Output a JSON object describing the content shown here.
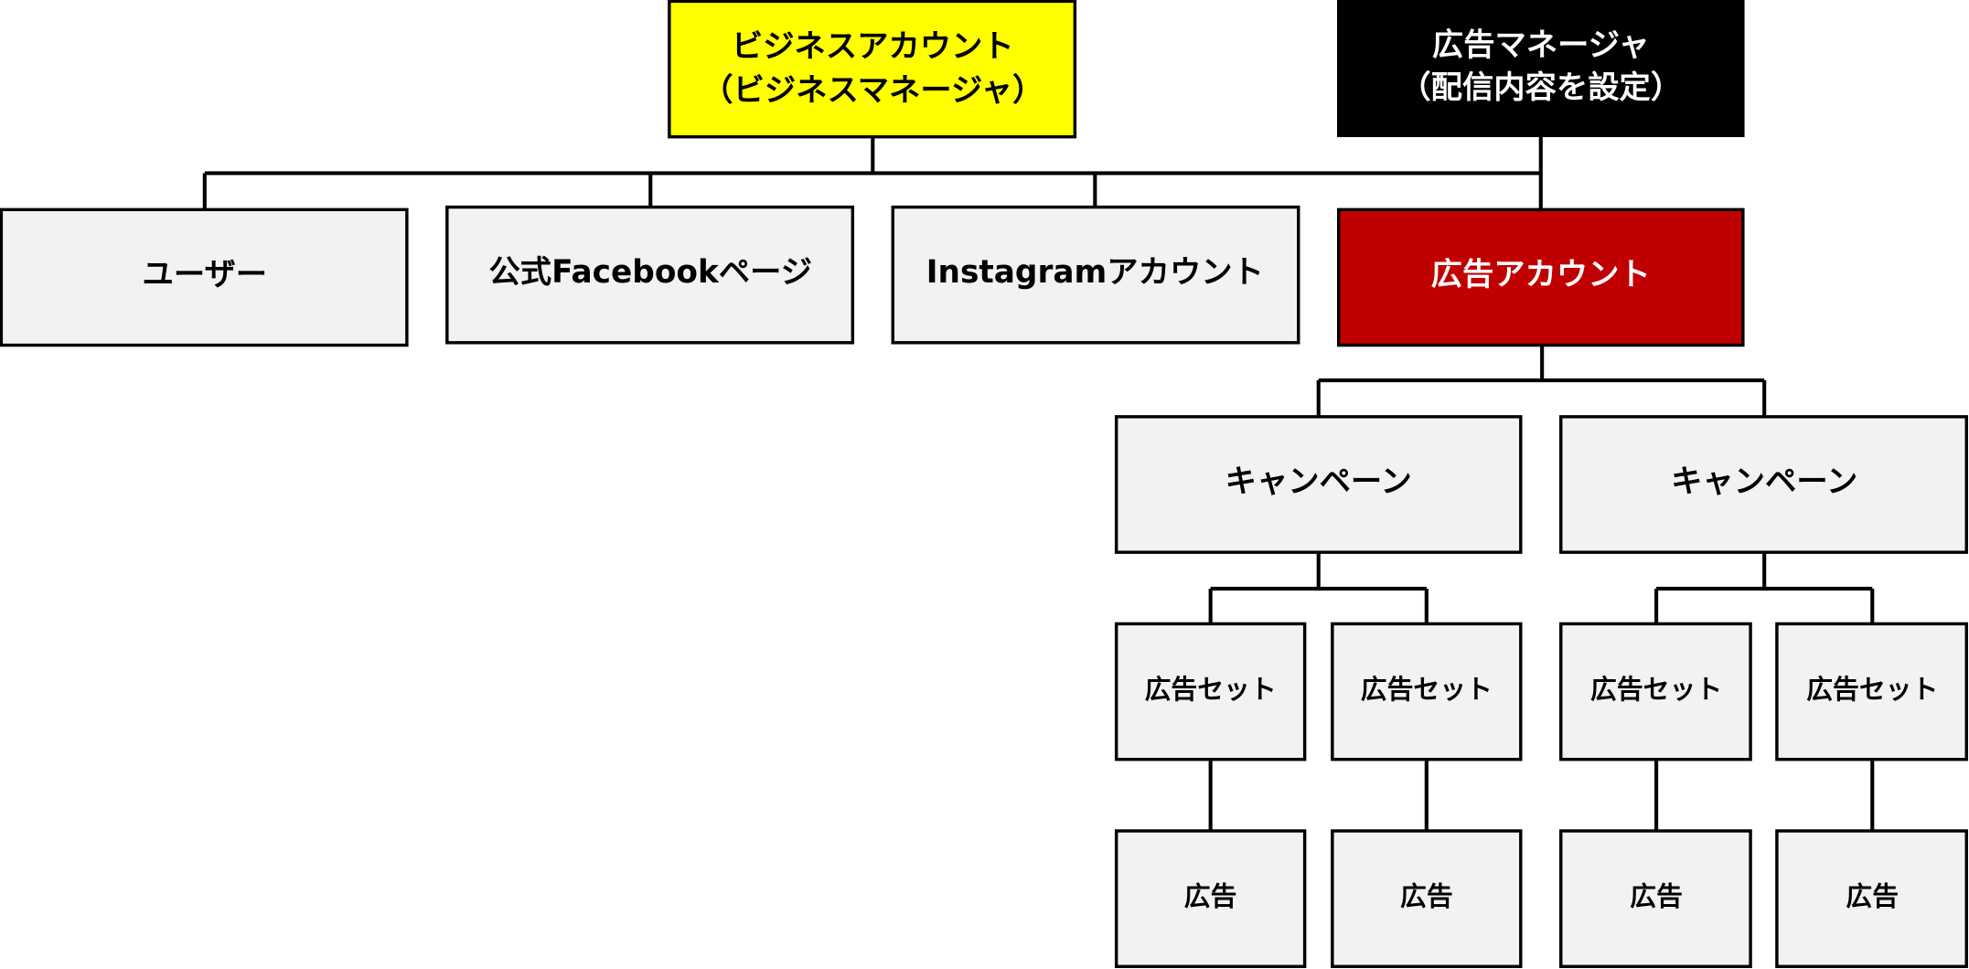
{
  "colors": {
    "business": "#FFFF00",
    "manager": "#000000",
    "ad_account": "#C00000",
    "node": "#F2F2F2"
  },
  "business_account": {
    "line1": "ビジネスアカウント",
    "line2": "（ビジネスマネージャ）"
  },
  "ads_manager": {
    "line1": "広告マネージャ",
    "line2": "（配信内容を設定）"
  },
  "level2": [
    "ユーザー",
    "公式Facebookページ",
    "Instagramアカウント",
    "広告アカウント"
  ],
  "campaigns": [
    "キャンペーン",
    "キャンペーン"
  ],
  "ad_sets": [
    "広告セット",
    "広告セット",
    "広告セット",
    "広告セット"
  ],
  "ads": [
    "広告",
    "広告",
    "広告",
    "広告"
  ]
}
